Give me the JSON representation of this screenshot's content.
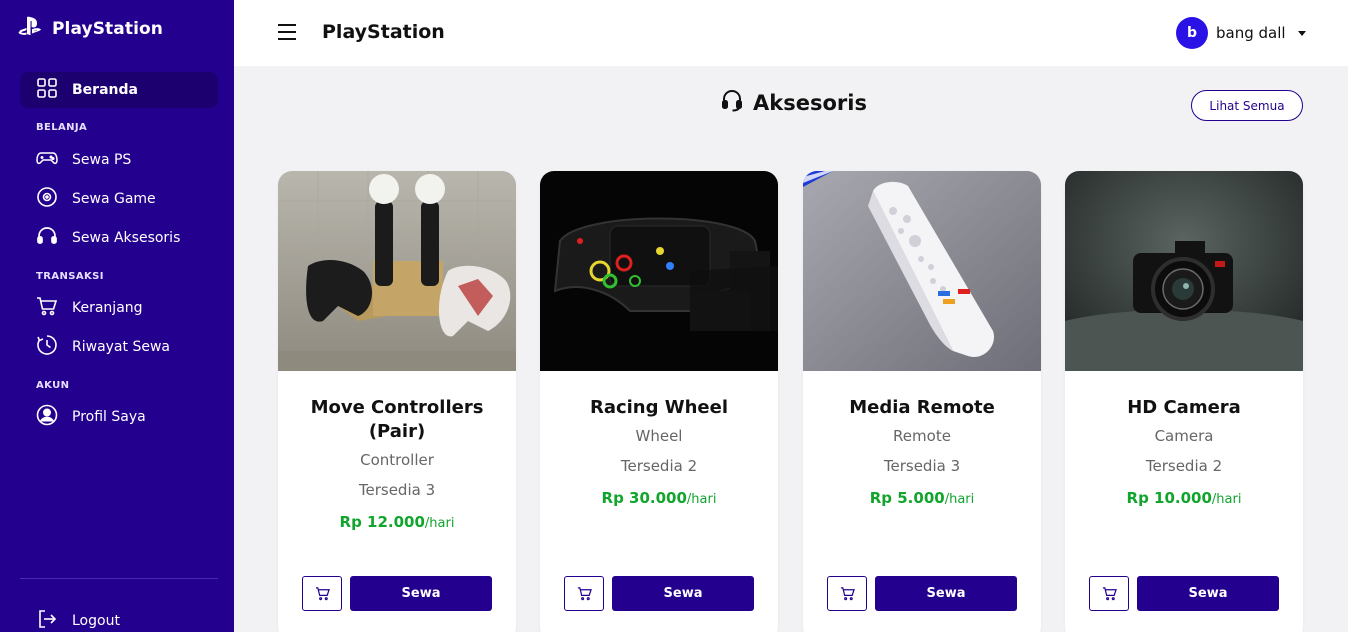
{
  "sidebar": {
    "brand": "PlayStation",
    "items": [
      {
        "label": "Beranda",
        "icon": "grid-icon"
      },
      {
        "label": "Sewa PS",
        "icon": "gamepad-icon"
      },
      {
        "label": "Sewa Game",
        "icon": "disc-icon"
      },
      {
        "label": "Sewa Aksesoris",
        "icon": "headset-icon"
      },
      {
        "label": "Keranjang",
        "icon": "cart-icon"
      },
      {
        "label": "Riwayat Sewa",
        "icon": "history-icon"
      },
      {
        "label": "Profil Saya",
        "icon": "user-circle-icon"
      }
    ],
    "sections": [
      "BELANJA",
      "TRANSAKSI",
      "AKUN"
    ],
    "logout": "Logout"
  },
  "header": {
    "title": "PlayStation",
    "user": {
      "initial": "b",
      "name": "bang dall"
    }
  },
  "section": {
    "title": "Aksesoris",
    "see_all": "Lihat Semua"
  },
  "products": [
    {
      "name": "Move Controllers (Pair)",
      "type": "Controller",
      "stock": "Tersedia 3",
      "price": "Rp 12.000",
      "unit": "/hari",
      "rent": "Sewa"
    },
    {
      "name": "Racing Wheel",
      "type": "Wheel",
      "stock": "Tersedia 2",
      "price": "Rp 30.000",
      "unit": "/hari",
      "rent": "Sewa"
    },
    {
      "name": "Media Remote",
      "type": "Remote",
      "stock": "Tersedia 3",
      "price": "Rp 5.000",
      "unit": "/hari",
      "rent": "Sewa"
    },
    {
      "name": "HD Camera",
      "type": "Camera",
      "stock": "Tersedia 2",
      "price": "Rp 10.000",
      "unit": "/hari",
      "rent": "Sewa"
    }
  ],
  "colors": {
    "sidebar_bg": "#24008f",
    "accent": "#24008f",
    "price": "#12a52e",
    "avatar": "#2a12e6"
  }
}
